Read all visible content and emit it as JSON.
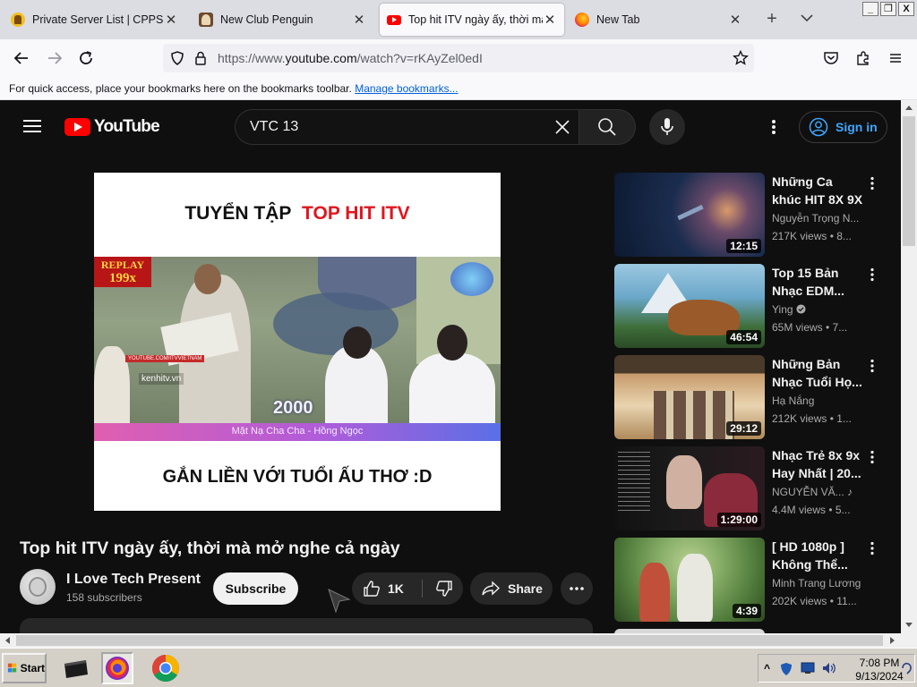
{
  "browser": {
    "tabs": [
      {
        "label": "Private Server List | CPPS Wik",
        "icon": "cpps-wiki-favicon",
        "active": false
      },
      {
        "label": "New Club Penguin",
        "icon": "new-club-penguin-favicon",
        "active": false
      },
      {
        "label": "Top hit ITV ngày ấy, thời mà",
        "icon": "youtube-favicon",
        "active": true
      },
      {
        "label": "New Tab",
        "icon": "firefox-favicon",
        "active": false
      }
    ],
    "new_tab_label": "+",
    "window_buttons": {
      "minimize": "_",
      "restore": "❐",
      "close": "X"
    },
    "url": {
      "prefix": "https://www.",
      "host": "youtube.com",
      "path": "/watch?v=rKAyZel0edI"
    },
    "bookmarks_bar": {
      "text": "For quick access, place your bookmarks here on the bookmarks toolbar.",
      "link": "Manage bookmarks..."
    }
  },
  "youtube": {
    "logo_text": "YouTube",
    "search_value": "VTC 13",
    "sign_in_label": "Sign in",
    "player": {
      "header_black": "TUYỂN TẬP",
      "header_red": "TOP HIT ITV",
      "badge_line1": "REPLAY",
      "badge_line2": "199x",
      "frame_year": "2000",
      "frame_site": "kenhitv.vn",
      "frame_handle": "YOUTUBE.COM/ITVVIETNAM",
      "lower_third": "Mặt Nạ Cha Cha - Hồng Ngọc",
      "caption": "GẮN LIỀN VỚI TUỔI ẤU THƠ :D"
    },
    "video_title": "Top hit ITV ngày ấy, thời mà mở nghe cả ngày",
    "channel": {
      "name": "I Love Tech Present",
      "subscribers": "158 subscribers"
    },
    "subscribe_label": "Subscribe",
    "like_count": "1K",
    "share_label": "Share",
    "recommendations": [
      {
        "title": "Những Ca khúc HIT 8X 9X",
        "channel": "Nguyễn Trọng N...",
        "meta": "217K views • 8...",
        "duration": "12:15",
        "verified": false,
        "music_note": false,
        "thumb_colors": [
          "#1b2d4f",
          "#3a5a9a",
          "#d99a6a"
        ]
      },
      {
        "title": "Top 15 Bản Nhạc EDM...",
        "channel": "Ying",
        "meta": "65M views • 7...",
        "duration": "46:54",
        "verified": true,
        "music_note": false,
        "thumb_colors": [
          "#6aa7c9",
          "#3f6f3a",
          "#9a5a2a"
        ]
      },
      {
        "title": "Những Bản Nhạc Tuổi Họ...",
        "channel": "Hạ Nắng",
        "meta": "212K views • 1...",
        "duration": "29:12",
        "verified": false,
        "music_note": false,
        "thumb_colors": [
          "#c79a6a",
          "#7a5a3a",
          "#e8d4b0"
        ]
      },
      {
        "title": "Nhạc Trẻ 8x 9x Hay Nhất | 20...",
        "channel": "NGUYỄN VĂ...",
        "meta": "4.4M views • 5...",
        "duration": "1:29:00",
        "verified": false,
        "music_note": true,
        "thumb_colors": [
          "#1a1a1a",
          "#8a2a3a",
          "#d0b0a0"
        ]
      },
      {
        "title": "[ HD 1080p ] Không Thể...",
        "channel": "Minh Trang Lương",
        "meta": "202K views • 11...",
        "duration": "4:39",
        "verified": false,
        "music_note": false,
        "thumb_colors": [
          "#4f7a3a",
          "#8ab06a",
          "#c0503a"
        ]
      }
    ]
  },
  "taskbar": {
    "start_label": "Start",
    "apps": [
      "terminal-app-icon",
      "firefox-app-icon",
      "chrome-app-icon"
    ],
    "time": "7:08 PM",
    "date": "9/13/2024"
  }
}
